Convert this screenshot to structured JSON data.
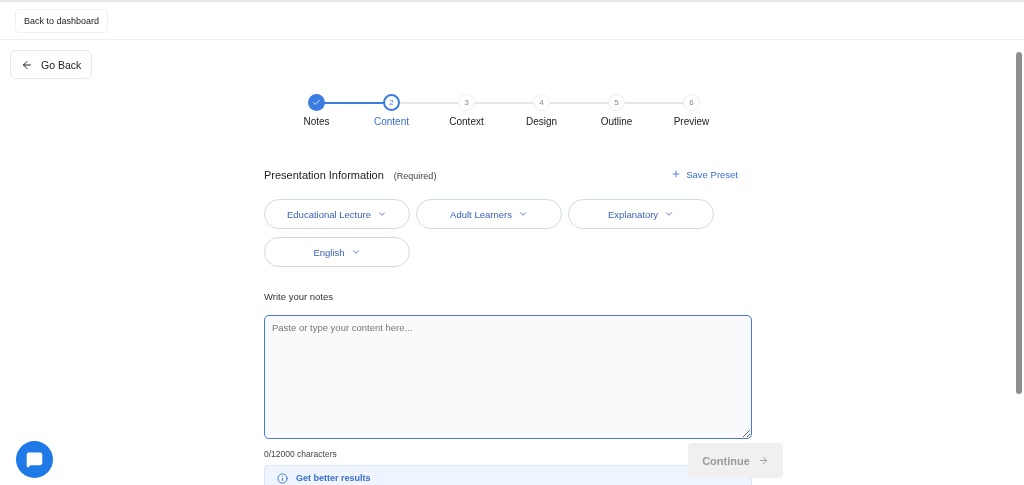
{
  "top_bar": {
    "back_link": "Back to dashboard"
  },
  "go_back": "Go Back",
  "steps": [
    {
      "label": "Notes",
      "completed": true,
      "selected": false
    },
    {
      "number": "2",
      "label": "Content",
      "completed": false,
      "selected": true
    },
    {
      "number": "3",
      "label": "Context",
      "completed": false,
      "selected": false
    },
    {
      "number": "4",
      "label": "Design",
      "completed": false,
      "selected": false
    },
    {
      "number": "5",
      "label": "Outline",
      "completed": false,
      "selected": false
    },
    {
      "number": "6",
      "label": "Preview",
      "completed": false,
      "selected": false
    }
  ],
  "section": {
    "title": "Presentation Information",
    "note": "(Required)",
    "action": "Save Preset"
  },
  "chips": [
    "Educational Lecture",
    "Adult Learners",
    "Explanatory",
    "English"
  ],
  "notes": {
    "label": "Write your notes",
    "placeholder": "Paste or type your content here...",
    "count": "0/12000 characters"
  },
  "tip": {
    "title": "Get better results"
  },
  "continue": {
    "label": "Continue",
    "disabled": true
  }
}
